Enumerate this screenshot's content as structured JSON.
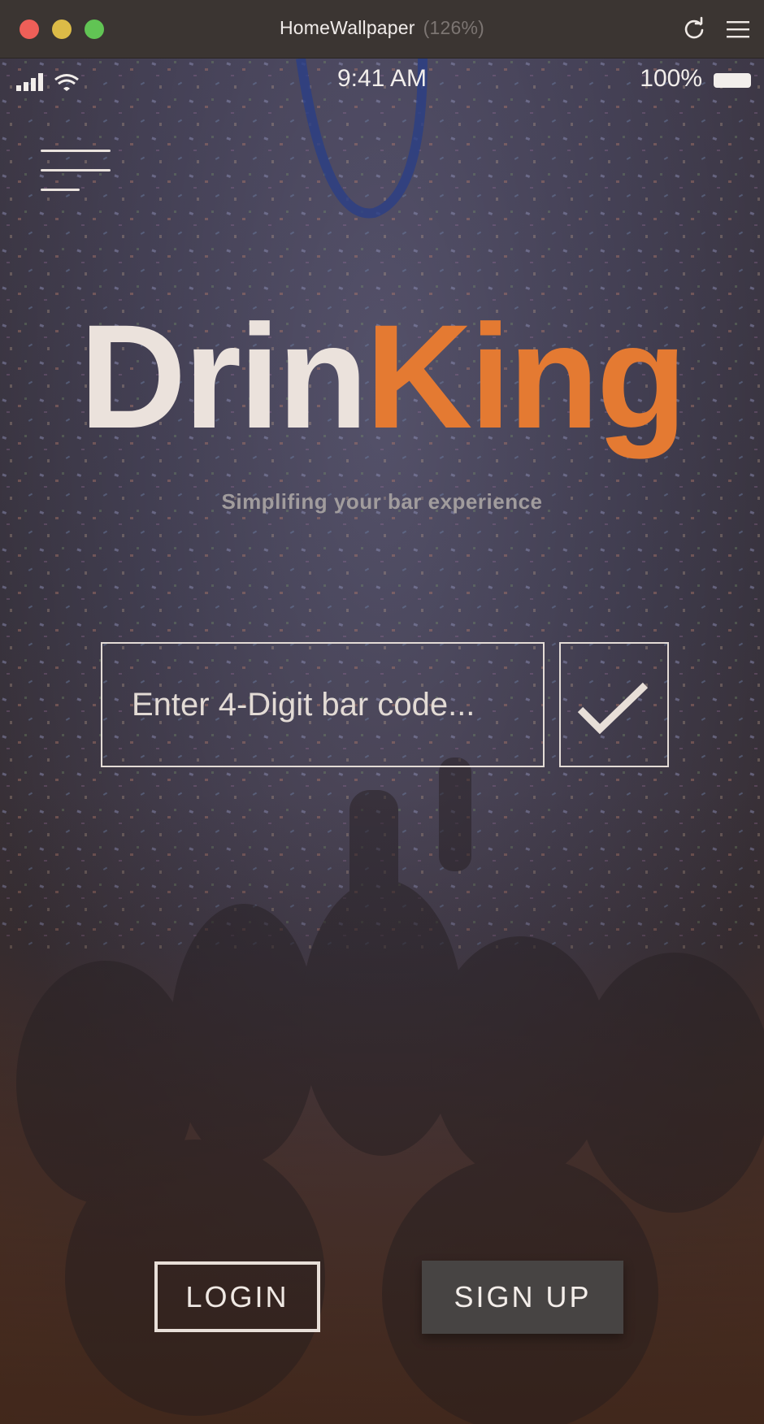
{
  "window": {
    "title": "HomeWallpaper",
    "zoom": "(126%)"
  },
  "status_bar": {
    "time": "9:41 AM",
    "battery": "100%"
  },
  "brand": {
    "part1": "Drin",
    "part2": "King",
    "tagline": "Simplifing your bar experience",
    "accent_color": "#e47a32"
  },
  "code_form": {
    "placeholder": "Enter 4-Digit bar code...",
    "value": ""
  },
  "actions": {
    "login_label": "LOGIN",
    "signup_label": "SIGN UP"
  }
}
